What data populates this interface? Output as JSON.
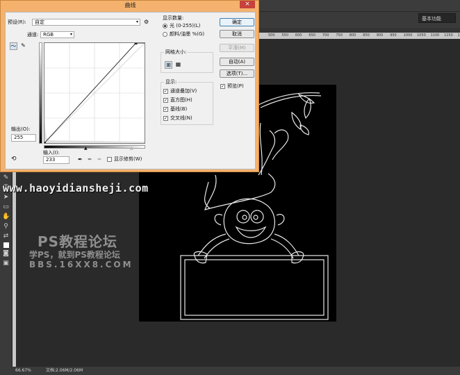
{
  "dialog": {
    "title": "曲线",
    "close_icon": "×",
    "preset_label": "预设(R):",
    "preset_value": "自定",
    "channel_label": "通道:",
    "channel_value": "RGB",
    "output_label": "输出(O):",
    "output_value": "255",
    "input_label": "输入(I):",
    "input_value": "233",
    "show_clipping_label": "显示修剪(W)",
    "show_amount": {
      "title": "显示数量:",
      "light_label": "光 (0-255)(L)",
      "pigment_label": "颜料/油墨 %(G)",
      "selected": "light"
    },
    "grid_size_title": "网格大小:",
    "display": {
      "title": "显示:",
      "options": [
        {
          "label": "通道叠加(V)",
          "checked": true
        },
        {
          "label": "直方图(H)",
          "checked": true
        },
        {
          "label": "基线(B)",
          "checked": true
        },
        {
          "label": "交叉线(N)",
          "checked": true
        }
      ]
    },
    "buttons": {
      "ok": "确定",
      "cancel": "取消",
      "smooth": "平滑(M)",
      "auto": "自动(A)",
      "options": "选项(T)..."
    },
    "preview_label": "预览(P)",
    "preview_checked": true,
    "curve": {
      "points": [
        [
          0,
          0
        ],
        [
          233,
          255
        ]
      ],
      "input_range": [
        0,
        255
      ],
      "output_range": [
        0,
        255
      ]
    }
  },
  "workspace": {
    "mode_label": "基本功能",
    "ruler_ticks": [
      "500",
      "550",
      "600",
      "650",
      "700",
      "750",
      "800",
      "850",
      "900",
      "950",
      "1000",
      "1050",
      "1100",
      "1150",
      "1200"
    ]
  },
  "status": {
    "zoom": "66.67%",
    "doc_info": "文档:2.06M/2.06M"
  },
  "watermark": {
    "url": "www.haoyidiansheji.com",
    "title": "PS教程论坛",
    "subtitle": "学PS，就到PS教程论坛",
    "bbs": "BBS.16XX8.COM"
  },
  "colors": {
    "dialog_frame": "#f4b26e",
    "close_button": "#c6423a",
    "canvas_bg": "#000000",
    "workspace_bg": "#282828"
  }
}
